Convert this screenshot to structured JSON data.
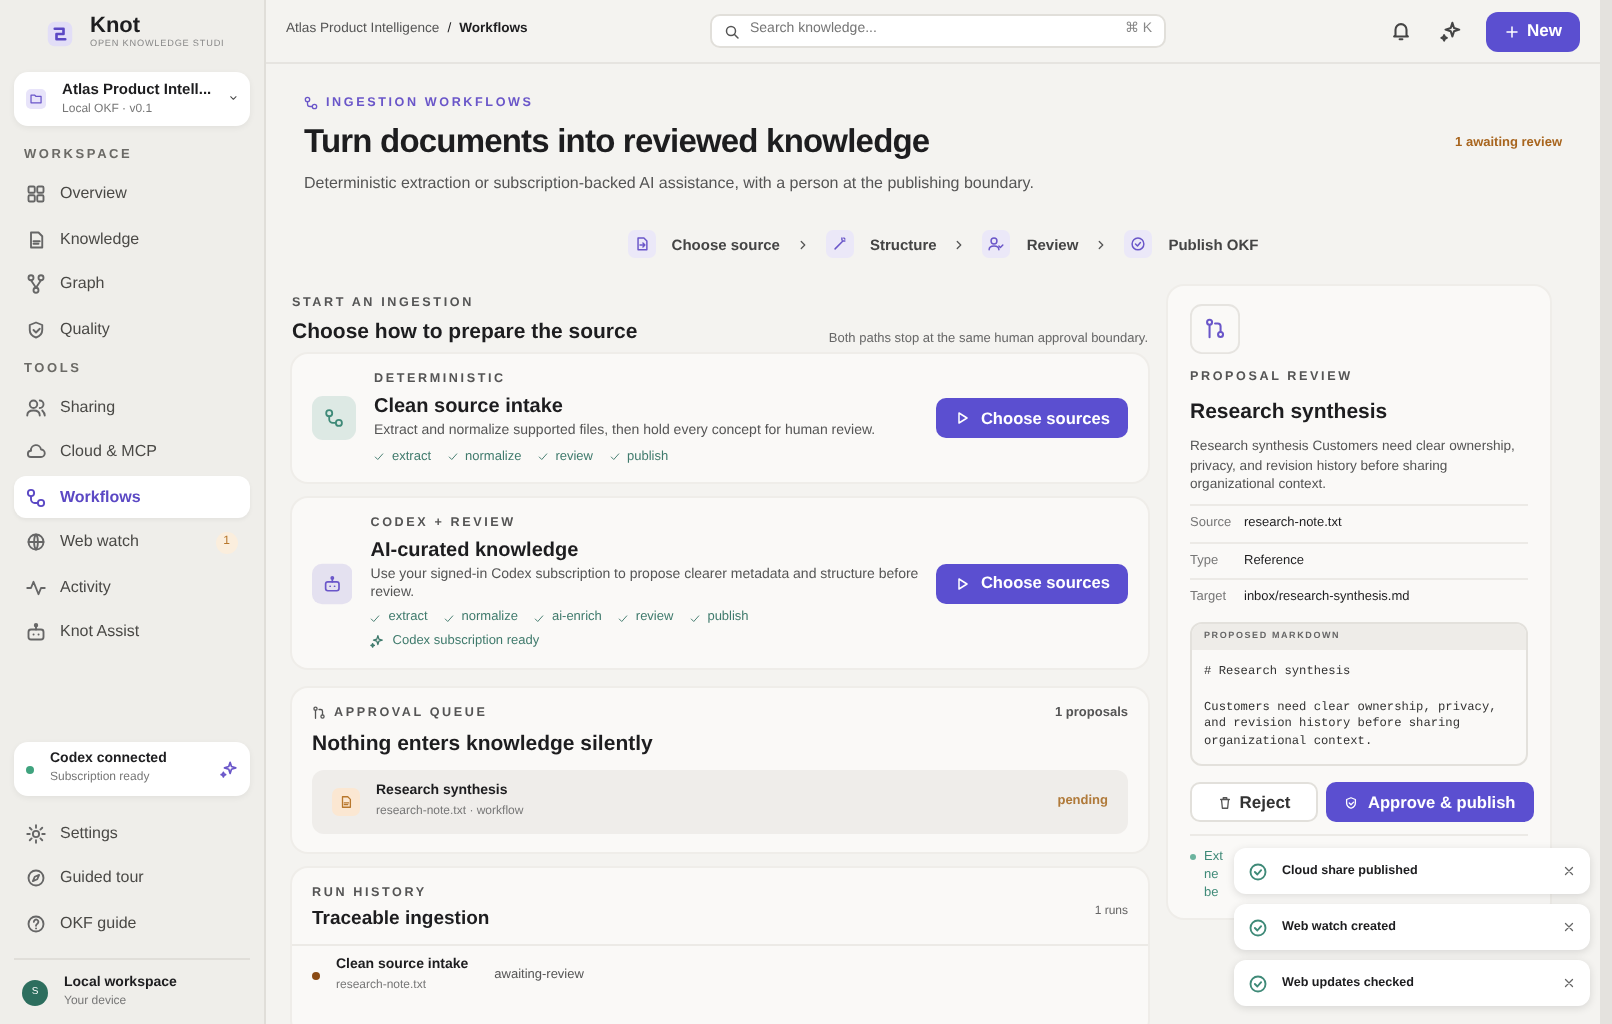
{
  "sidebar": {
    "brand": {
      "name": "Knot",
      "tagline": "OPEN KNOWLEDGE STUDI"
    },
    "workspace": {
      "name": "Atlas Product Intell...",
      "meta": "Local OKF · v0.1"
    },
    "sections": [
      {
        "title": "WORKSPACE",
        "items": [
          {
            "label": "Overview",
            "selected": false
          },
          {
            "label": "Knowledge",
            "selected": false
          },
          {
            "label": "Graph",
            "selected": false
          },
          {
            "label": "Quality",
            "selected": false
          }
        ]
      },
      {
        "title": "TOOLS",
        "items": [
          {
            "label": "Sharing",
            "selected": false
          },
          {
            "label": "Cloud & MCP",
            "selected": false
          },
          {
            "label": "Workflows",
            "selected": true
          },
          {
            "label": "Web watch",
            "selected": false,
            "badge": "1"
          },
          {
            "label": "Activity",
            "selected": false
          },
          {
            "label": "Knot Assist",
            "selected": false
          }
        ]
      }
    ],
    "codex": {
      "title": "Codex connected",
      "subtitle": "Subscription ready"
    },
    "footer_items": [
      {
        "label": "Settings"
      },
      {
        "label": "Guided tour"
      },
      {
        "label": "OKF guide"
      }
    ],
    "user": {
      "initial": "S",
      "name": "Local workspace",
      "subtitle": "Your device"
    }
  },
  "topbar": {
    "breadcrumb": [
      "Atlas Product Intelligence",
      "Workflows"
    ],
    "breadcrumb_separator": "/",
    "search": {
      "placeholder": "Search knowledge...",
      "shortcut": "⌘ K"
    },
    "new_button": "New"
  },
  "header": {
    "eyebrow": "INGESTION WORKFLOWS",
    "title": "Turn documents into reviewed knowledge",
    "subtitle": "Deterministic extraction or subscription-backed AI assistance, with a person at the publishing boundary.",
    "status": "1 awaiting review",
    "steps": [
      "Choose source",
      "Structure",
      "Review",
      "Publish OKF"
    ]
  },
  "start": {
    "eyebrow": "START AN INGESTION",
    "title": "Choose how to prepare the source",
    "note": "Both paths stop at the same human approval boundary.",
    "paths": [
      {
        "eyebrow": "DETERMINISTIC",
        "title": "Clean source intake",
        "description": "Extract and normalize supported files, then hold every concept for human review.",
        "steps": [
          "extract",
          "normalize",
          "review",
          "publish"
        ],
        "button": "Choose sources",
        "color": "#3f8a78"
      },
      {
        "eyebrow": "CODEX + REVIEW",
        "title": "AI-curated knowledge",
        "description": "Use your signed-in Codex subscription to propose clearer metadata and structure before review.",
        "steps": [
          "extract",
          "normalize",
          "ai-enrich",
          "review",
          "publish"
        ],
        "status": "Codex subscription ready",
        "button": "Choose sources",
        "color": "#6a56c9"
      }
    ]
  },
  "approval_queue": {
    "eyebrow": "APPROVAL QUEUE",
    "title": "Nothing enters knowledge silently",
    "count": "1 proposals",
    "items": [
      {
        "title": "Research synthesis",
        "meta": "research-note.txt · workflow",
        "status": "pending"
      }
    ]
  },
  "run_history": {
    "eyebrow": "RUN HISTORY",
    "title": "Traceable ingestion",
    "count": "1 runs",
    "runs": [
      {
        "title": "Clean source intake",
        "file": "research-note.txt",
        "status": "awaiting-review",
        "color": "#8a4b14"
      }
    ]
  },
  "proposal": {
    "eyebrow": "PROPOSAL REVIEW",
    "title": "Research synthesis",
    "description": "Research synthesis Customers need clear ownership, privacy, and revision history before sharing organizational context.",
    "fields": [
      {
        "label": "Source",
        "value": "research-note.txt"
      },
      {
        "label": "Type",
        "value": "Reference"
      },
      {
        "label": "Target",
        "value": "inbox/research-synthesis.md"
      }
    ],
    "markdown": {
      "title": "PROPOSED MARKDOWN",
      "body": "# Research synthesis\n\nCustomers need clear ownership, privacy,\nand revision history before sharing\norganizational context."
    },
    "reject_button": "Reject",
    "approve_button": "Approve & publish",
    "note_lines": [
      "Ext",
      "ne",
      "be"
    ]
  },
  "toasts": [
    {
      "title": "Cloud share published"
    },
    {
      "title": "Web watch created"
    },
    {
      "title": "Web updates checked"
    }
  ]
}
